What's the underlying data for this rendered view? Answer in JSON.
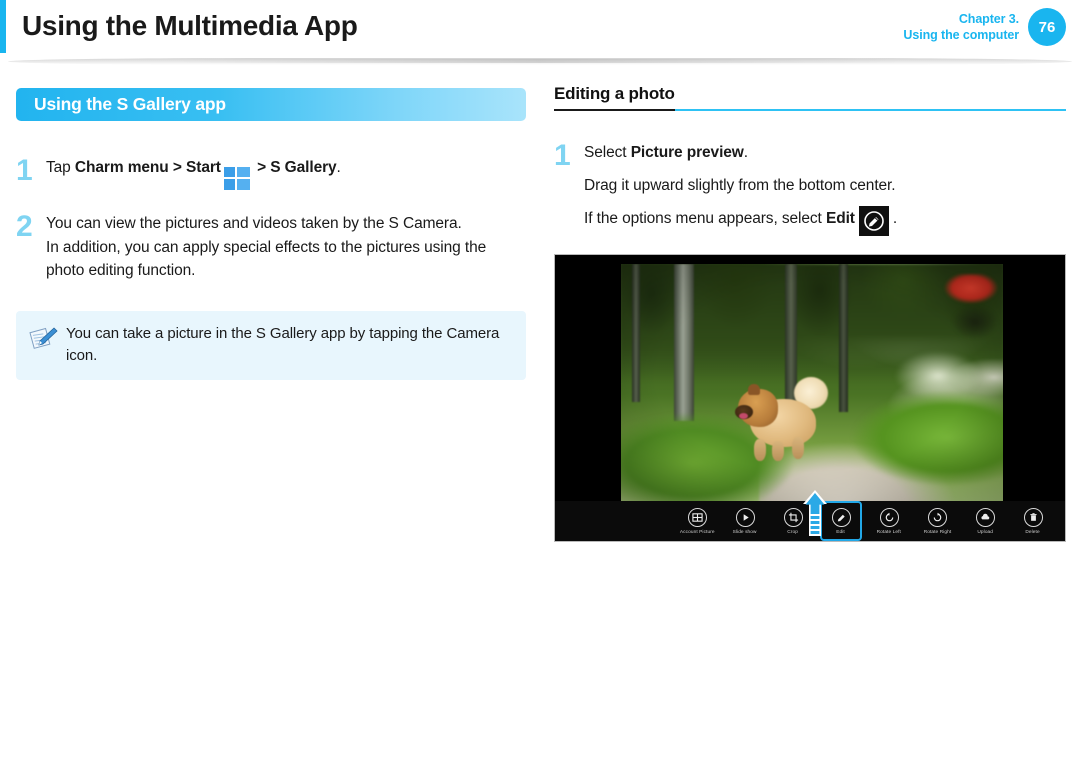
{
  "header": {
    "title": "Using the Multimedia App",
    "chapter_line1": "Chapter 3.",
    "chapter_line2": "Using the computer",
    "page_number": "76",
    "accent_color": "#19b5ef"
  },
  "left_column": {
    "banner_label": "Using the S Gallery app",
    "steps": [
      {
        "number": "1",
        "lines": [
          {
            "pre": "Tap ",
            "bold1": "Charm menu",
            "mid": " > ",
            "bold2": "Start",
            "icon": "windows-logo-icon",
            "post": " > ",
            "bold3": "S Gallery",
            "end": "."
          }
        ]
      },
      {
        "number": "2",
        "lines": [
          "You can view the pictures and videos taken by the S Camera.",
          "In addition, you can apply special effects to the pictures using the photo editing function."
        ]
      }
    ],
    "note": {
      "icon": "note-pen-icon",
      "text": "You can take a picture in the S Gallery app by tapping the Camera icon.",
      "background_color": "#e8f6fd"
    }
  },
  "right_column": {
    "heading": "Editing a photo",
    "step": {
      "number": "1",
      "line1_pre": "Select ",
      "line1_bold": "Picture preview",
      "line1_end": ".",
      "line2": "Drag it upward slightly from the bottom center.",
      "line3_pre": "If the options menu appears, select ",
      "line3_bold": "Edit",
      "line3_icon": "edit-pencil-icon",
      "line3_end": "."
    },
    "screenshot": {
      "photo_description": "Fluffy tan puppy standing on a forest path",
      "drag_arrow": "up-arrow-overlay-icon",
      "toolbar": [
        {
          "label": "Account Picture",
          "icon": "account-picture-icon",
          "selected": false
        },
        {
          "label": "Slide show",
          "icon": "slideshow-icon",
          "selected": false
        },
        {
          "label": "Crop",
          "icon": "crop-icon",
          "selected": false
        },
        {
          "label": "Edit",
          "icon": "edit-pencil-icon",
          "selected": true
        },
        {
          "label": "Rotate Left",
          "icon": "rotate-left-icon",
          "selected": false
        },
        {
          "label": "Rotate Right",
          "icon": "rotate-right-icon",
          "selected": false
        },
        {
          "label": "Upload",
          "icon": "upload-cloud-icon",
          "selected": false
        },
        {
          "label": "Delete",
          "icon": "delete-trash-icon",
          "selected": false
        }
      ]
    }
  }
}
